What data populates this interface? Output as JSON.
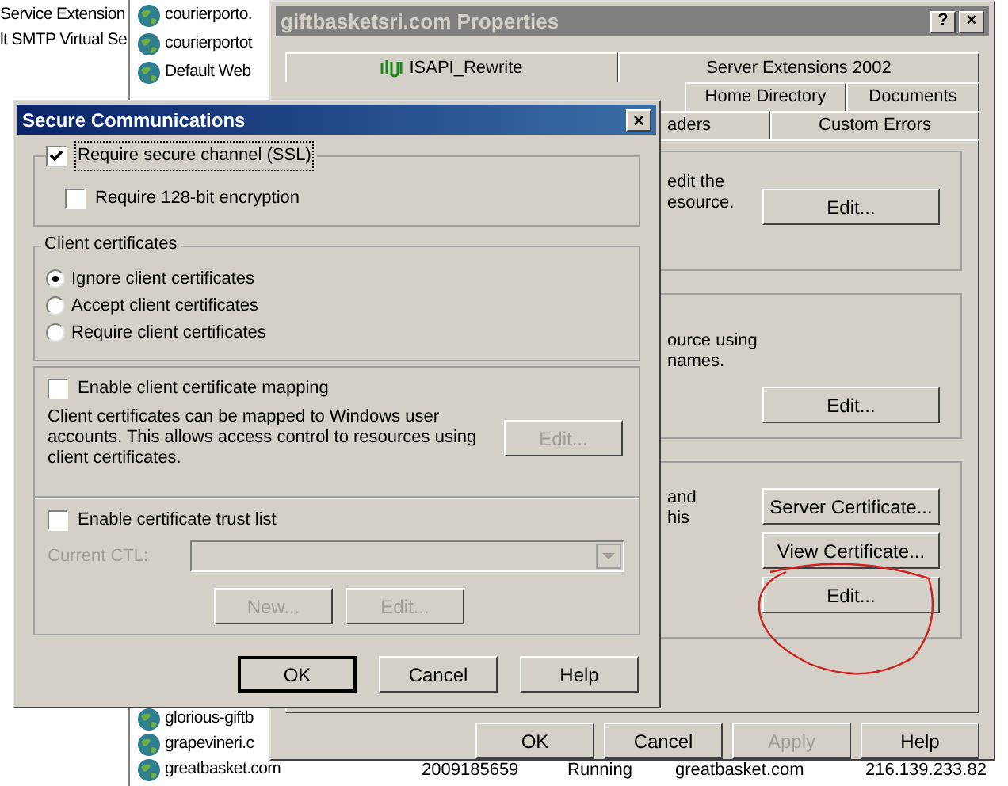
{
  "left_pane": {
    "lines": [
      "Service Extension",
      "lt SMTP Virtual Se"
    ]
  },
  "site_list": {
    "top_rows": [
      {
        "name": "courierporto."
      },
      {
        "name": "courierportot"
      },
      {
        "name": "Default Web"
      }
    ],
    "bottom_rows": [
      {
        "name": "glorious-giftb",
        "cells": []
      },
      {
        "name": "grapevineri.c",
        "cells": []
      },
      {
        "name": "greatbasket.com",
        "cells": [
          "2009185659",
          "Running",
          "greatbasket.com",
          "216.139.233.82"
        ]
      }
    ]
  },
  "properties_window": {
    "title": "giftbasketsri.com Properties",
    "title_buttons": [
      "?",
      "×"
    ],
    "tabs_row_1": [
      {
        "label": "ISAPI_Rewrite",
        "kind": "icon"
      },
      {
        "label": "Server Extensions 2002",
        "kind": "plain"
      }
    ],
    "tabs_row_2": [
      {
        "label": "Home Directory"
      },
      {
        "label": "Documents"
      }
    ],
    "tabs_row_3": [
      {
        "label": "aders"
      },
      {
        "label": "Custom Errors"
      }
    ],
    "groups": [
      {
        "text_lines": [
          "edit the",
          "esource."
        ],
        "buttons": [
          {
            "label": "Edit...",
            "disabled": false
          }
        ]
      },
      {
        "text_lines": [
          "ource using",
          "names."
        ],
        "buttons": [
          {
            "label": "Edit...",
            "disabled": false
          }
        ]
      },
      {
        "text_lines": [
          "and",
          "his"
        ],
        "buttons": [
          {
            "label": "Server Certificate...",
            "disabled": false
          },
          {
            "label": "View Certificate...",
            "disabled": false
          },
          {
            "label": "Edit...",
            "disabled": false
          }
        ]
      }
    ],
    "buttons": [
      {
        "label": "OK",
        "disabled": false
      },
      {
        "label": "Cancel",
        "disabled": false
      },
      {
        "label": "Apply",
        "disabled": true
      },
      {
        "label": "Help",
        "disabled": false
      }
    ]
  },
  "dialog": {
    "title": "Secure Communications",
    "close": "×",
    "require_ssl": {
      "label": "Require secure channel (SSL)",
      "checked": true
    },
    "require_128": {
      "label": "Require 128-bit encryption",
      "checked": false
    },
    "client_certificates": {
      "legend": "Client certificates",
      "options": [
        {
          "label": "Ignore client certificates",
          "selected": true
        },
        {
          "label": "Accept client certificates",
          "selected": false
        },
        {
          "label": "Require client certificates",
          "selected": false
        }
      ]
    },
    "mapping": {
      "label": "Enable client certificate mapping",
      "checked": false,
      "description": "Client certificates can be mapped to Windows user accounts.  This allows access control to resources using client certificates.",
      "button": {
        "label": "Edit...",
        "disabled": true
      }
    },
    "trust_list": {
      "label": "Enable certificate trust list",
      "checked": false,
      "ctl_label": "Current CTL:",
      "disabled": true,
      "buttons": [
        {
          "label": "New...",
          "disabled": true
        },
        {
          "label": "Edit...",
          "disabled": true
        }
      ]
    },
    "buttons": [
      {
        "label": "OK",
        "disabled": false,
        "default": true
      },
      {
        "label": "Cancel",
        "disabled": false,
        "default": false
      },
      {
        "label": "Help",
        "disabled": false,
        "default": false
      }
    ]
  }
}
